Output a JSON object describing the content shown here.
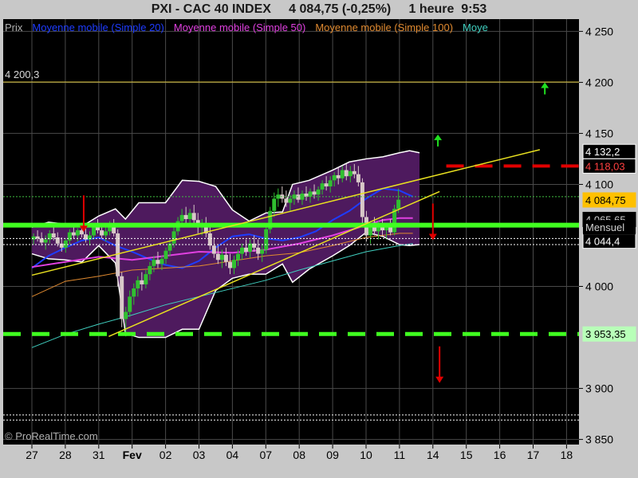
{
  "chart_data": {
    "type": "candlestick",
    "title": "PXI - CAC 40 INDEX     4 084,75 (-0,25%)     1 heure  9:53",
    "legend": [
      {
        "label": "Prix",
        "color": "#b0b0b0"
      },
      {
        "label": "Moyenne mobile (Simple 20)",
        "color": "#1e3cff"
      },
      {
        "label": "Moyenne mobile (Simple 50)",
        "color": "#e040e0"
      },
      {
        "label": "Moyenne mobile (Simple 100)",
        "color": "#e08a30"
      },
      {
        "label": "Moye",
        "color": "#40d0c0"
      }
    ],
    "y_ticks": [
      {
        "value": 4250,
        "label": "4 250"
      },
      {
        "value": 4200,
        "label": "4 200"
      },
      {
        "value": 4150,
        "label": "4 150"
      },
      {
        "value": 4100,
        "label": "4 100"
      },
      {
        "value": 4000,
        "label": "4 000"
      },
      {
        "value": 3900,
        "label": "3 900"
      },
      {
        "value": 3850,
        "label": "3 850"
      }
    ],
    "ylim": [
      3845,
      4262
    ],
    "x_labels": [
      "27",
      "28",
      "31",
      "Fev",
      "02",
      "03",
      "04",
      "07",
      "08",
      "09",
      "10",
      "11",
      "14",
      "15",
      "16",
      "17",
      "18"
    ],
    "price_tags": [
      {
        "value": 4132.2,
        "label": "4 132,2",
        "bg": "#000000",
        "fg": "#ffffff",
        "border": "#ffffff"
      },
      {
        "value": 4118.03,
        "label": "4 118,03",
        "bg": "#000000",
        "fg": "#ff4040",
        "border": "#ffffff"
      },
      {
        "value": 4084.75,
        "label": "4 084,75",
        "bg": "#ffc000",
        "fg": "#000000",
        "border": "#ffc000"
      },
      {
        "value": 4065.65,
        "label": "4 065,65",
        "bg": "#000000",
        "fg": "#d0d0d0",
        "border": "#000000"
      },
      {
        "value": 4044.4,
        "label": "4 044,4",
        "bg": "#000000",
        "fg": "#ffffff",
        "border": "#ffffff"
      },
      {
        "value": 3953.35,
        "label": "3 953,35",
        "bg": "#b8ffb8",
        "fg": "#000000",
        "border": "#b8ffb8"
      }
    ],
    "level_labels": [
      {
        "value": 4200.3,
        "label": "4 200,3"
      },
      {
        "value": 4058,
        "label": "Mensuel"
      }
    ],
    "horizontal_levels": [
      {
        "value": 4200.3,
        "style": "solid",
        "color": "#e8d040",
        "width": 1
      },
      {
        "value": 4118.03,
        "style": "dashed",
        "color": "#e00000",
        "width": 4,
        "from_x": 12.4
      },
      {
        "value": 4088,
        "style": "dotted",
        "color": "#40c040",
        "width": 1
      },
      {
        "value": 4060,
        "style": "solid",
        "color": "#40ff20",
        "width": 6
      },
      {
        "value": 4047,
        "style": "dotted",
        "color": "#ffffff",
        "width": 1
      },
      {
        "value": 4041,
        "style": "dotted",
        "color": "#ffffff",
        "width": 1
      },
      {
        "value": 3953.35,
        "style": "dashed",
        "color": "#40ff20",
        "width": 5
      },
      {
        "value": 3874,
        "style": "dotted",
        "color": "#ffffff",
        "width": 1
      },
      {
        "value": 3869,
        "style": "dotted",
        "color": "#ffffff",
        "width": 1
      }
    ],
    "trend_lines": [
      {
        "points": [
          [
            0,
            4011
          ],
          [
            15.2,
            4134
          ]
        ],
        "color": "#e8e020"
      },
      {
        "points": [
          [
            2.3,
            3951
          ],
          [
            12.2,
            4093
          ]
        ],
        "color": "#e8e020"
      }
    ],
    "arrows": [
      {
        "x": 15.35,
        "value": 4196,
        "direction": "up",
        "color": "#20e020"
      },
      {
        "x": 12.15,
        "value": 4145,
        "direction": "up",
        "color": "#20e020"
      },
      {
        "x": 12.0,
        "value": 4050,
        "direction": "down",
        "color": "#e00000"
      },
      {
        "x": 12.2,
        "value": 3910,
        "direction": "down",
        "color": "#e00000"
      },
      {
        "x": 1.55,
        "value": 4058,
        "direction": "down",
        "color": "#e00000"
      }
    ],
    "bollinger": {
      "x": [
        0,
        0.5,
        1,
        1.5,
        2,
        2.5,
        2.8,
        3.2,
        4,
        4.5,
        5,
        5.5,
        6,
        6.5,
        7,
        7.5,
        7.8,
        8.3,
        9,
        9.5,
        10,
        10.5,
        11,
        11.3,
        11.6
      ],
      "upper": [
        4058,
        4063,
        4061,
        4059,
        4069,
        4076,
        4066,
        4082,
        4082,
        4104,
        4103,
        4098,
        4075,
        4064,
        4072,
        4073,
        4100,
        4104,
        4114,
        4122,
        4125,
        4127,
        4131,
        4133,
        4131
      ],
      "lower": [
        4032,
        4027,
        4026,
        4024,
        4040,
        4023,
        3954,
        3950,
        3950,
        3958,
        3958,
        3996,
        4008,
        4012,
        4012,
        4022,
        4004,
        4017,
        4030,
        4040,
        4053,
        4049,
        4041,
        4040,
        4041
      ]
    },
    "moving_averages": [
      {
        "name": "Moyenne mobile (Simple 20)",
        "color": "#1e3cff",
        "width": 2,
        "x": [
          0,
          0.5,
          1,
          1.5,
          2,
          2.5,
          3,
          3.5,
          4,
          4.5,
          5,
          5.5,
          6,
          6.5,
          7,
          7.5,
          8,
          8.5,
          9,
          9.5,
          10,
          10.5,
          11,
          11.4
        ],
        "values": [
          4018,
          4030,
          4038,
          4045,
          4048,
          4040,
          4034,
          4027,
          4021,
          4018,
          4025,
          4038,
          4049,
          4051,
          4047,
          4045,
          4048,
          4054,
          4065,
          4074,
          4086,
          4096,
          4094,
          4088
        ]
      },
      {
        "name": "Moyenne mobile (Simple 50)",
        "color": "#e040e0",
        "width": 2,
        "x": [
          0,
          1,
          2,
          3,
          4,
          5,
          6,
          7,
          8,
          9,
          10,
          10.5,
          11,
          11.4
        ],
        "values": [
          4019,
          4024,
          4029,
          4026,
          4030,
          4034,
          4033,
          4036,
          4042,
          4050,
          4060,
          4065,
          4067,
          4067
        ]
      },
      {
        "name": "Moyenne mobile (Simple 100)",
        "color": "#e08a30",
        "width": 1,
        "x": [
          0,
          1,
          2,
          3,
          4,
          5,
          6,
          7,
          8,
          9,
          10,
          11,
          11.4
        ],
        "values": [
          3990,
          4005,
          4010,
          4016,
          4018,
          4020,
          4025,
          4030,
          4033,
          4040,
          4048,
          4052,
          4052
        ]
      },
      {
        "name": "Moye",
        "color": "#40d0c0",
        "width": 1,
        "x": [
          0,
          1,
          2,
          3,
          4,
          5,
          6,
          7,
          8,
          9,
          10,
          11,
          11.4
        ],
        "values": [
          3940,
          3953,
          3963,
          3972,
          3982,
          3990,
          3998,
          4006,
          4016,
          4025,
          4034,
          4040,
          4042
        ]
      }
    ],
    "candles": [
      {
        "x": 0.05,
        "o": 4046,
        "h": 4052,
        "l": 4041,
        "c": 4049
      },
      {
        "x": 0.17,
        "o": 4049,
        "h": 4055,
        "l": 4044,
        "c": 4047
      },
      {
        "x": 0.29,
        "o": 4047,
        "h": 4053,
        "l": 4040,
        "c": 4043
      },
      {
        "x": 0.41,
        "o": 4043,
        "h": 4050,
        "l": 4036,
        "c": 4046
      },
      {
        "x": 0.53,
        "o": 4046,
        "h": 4055,
        "l": 4042,
        "c": 4052
      },
      {
        "x": 0.65,
        "o": 4052,
        "h": 4058,
        "l": 4045,
        "c": 4048
      },
      {
        "x": 0.77,
        "o": 4048,
        "h": 4053,
        "l": 4039,
        "c": 4042
      },
      {
        "x": 0.89,
        "o": 4042,
        "h": 4048,
        "l": 4034,
        "c": 4038
      },
      {
        "x": 1.01,
        "o": 4038,
        "h": 4047,
        "l": 4033,
        "c": 4045
      },
      {
        "x": 1.13,
        "o": 4045,
        "h": 4056,
        "l": 4041,
        "c": 4053
      },
      {
        "x": 1.25,
        "o": 4053,
        "h": 4061,
        "l": 4047,
        "c": 4050
      },
      {
        "x": 1.37,
        "o": 4050,
        "h": 4057,
        "l": 4044,
        "c": 4055
      },
      {
        "x": 1.49,
        "o": 4055,
        "h": 4062,
        "l": 4048,
        "c": 4051
      },
      {
        "x": 1.61,
        "o": 4051,
        "h": 4058,
        "l": 4043,
        "c": 4046
      },
      {
        "x": 1.73,
        "o": 4046,
        "h": 4054,
        "l": 4040,
        "c": 4050
      },
      {
        "x": 1.85,
        "o": 4050,
        "h": 4062,
        "l": 4046,
        "c": 4059
      },
      {
        "x": 1.97,
        "o": 4059,
        "h": 4066,
        "l": 4052,
        "c": 4055
      },
      {
        "x": 2.09,
        "o": 4055,
        "h": 4062,
        "l": 4047,
        "c": 4050
      },
      {
        "x": 2.21,
        "o": 4050,
        "h": 4058,
        "l": 4044,
        "c": 4054
      },
      {
        "x": 2.33,
        "o": 4054,
        "h": 4064,
        "l": 4050,
        "c": 4060
      },
      {
        "x": 2.45,
        "o": 4060,
        "h": 4066,
        "l": 4049,
        "c": 4052
      },
      {
        "x": 2.57,
        "o": 4052,
        "h": 4056,
        "l": 4000,
        "c": 4010
      },
      {
        "x": 2.69,
        "o": 4010,
        "h": 4014,
        "l": 3960,
        "c": 3968
      },
      {
        "x": 2.81,
        "o": 3968,
        "h": 3980,
        "l": 3951,
        "c": 3975
      },
      {
        "x": 2.93,
        "o": 3975,
        "h": 3996,
        "l": 3970,
        "c": 3990
      },
      {
        "x": 3.05,
        "o": 3990,
        "h": 4003,
        "l": 3982,
        "c": 3998
      },
      {
        "x": 3.17,
        "o": 3998,
        "h": 4010,
        "l": 3990,
        "c": 4006
      },
      {
        "x": 3.29,
        "o": 4006,
        "h": 4014,
        "l": 3996,
        "c": 4002
      },
      {
        "x": 3.41,
        "o": 4002,
        "h": 4016,
        "l": 3998,
        "c": 4012
      },
      {
        "x": 3.53,
        "o": 4012,
        "h": 4024,
        "l": 4006,
        "c": 4020
      },
      {
        "x": 3.65,
        "o": 4020,
        "h": 4030,
        "l": 4014,
        "c": 4026
      },
      {
        "x": 3.77,
        "o": 4026,
        "h": 4034,
        "l": 4018,
        "c": 4022
      },
      {
        "x": 3.89,
        "o": 4022,
        "h": 4030,
        "l": 4016,
        "c": 4027
      },
      {
        "x": 4.01,
        "o": 4027,
        "h": 4038,
        "l": 4022,
        "c": 4035
      },
      {
        "x": 4.13,
        "o": 4035,
        "h": 4046,
        "l": 4030,
        "c": 4042
      },
      {
        "x": 4.25,
        "o": 4042,
        "h": 4058,
        "l": 4038,
        "c": 4054
      },
      {
        "x": 4.37,
        "o": 4054,
        "h": 4068,
        "l": 4050,
        "c": 4064
      },
      {
        "x": 4.49,
        "o": 4064,
        "h": 4076,
        "l": 4058,
        "c": 4070
      },
      {
        "x": 4.61,
        "o": 4070,
        "h": 4078,
        "l": 4062,
        "c": 4066
      },
      {
        "x": 4.73,
        "o": 4066,
        "h": 4076,
        "l": 4058,
        "c": 4072
      },
      {
        "x": 4.85,
        "o": 4072,
        "h": 4080,
        "l": 4062,
        "c": 4065
      },
      {
        "x": 4.97,
        "o": 4065,
        "h": 4072,
        "l": 4052,
        "c": 4058
      },
      {
        "x": 5.09,
        "o": 4058,
        "h": 4066,
        "l": 4050,
        "c": 4062
      },
      {
        "x": 5.21,
        "o": 4062,
        "h": 4068,
        "l": 4048,
        "c": 4052
      },
      {
        "x": 5.33,
        "o": 4052,
        "h": 4058,
        "l": 4036,
        "c": 4040
      },
      {
        "x": 5.45,
        "o": 4040,
        "h": 4048,
        "l": 4028,
        "c": 4032
      },
      {
        "x": 5.57,
        "o": 4032,
        "h": 4040,
        "l": 4022,
        "c": 4026
      },
      {
        "x": 5.69,
        "o": 4026,
        "h": 4036,
        "l": 4018,
        "c": 4031
      },
      {
        "x": 5.81,
        "o": 4031,
        "h": 4038,
        "l": 4020,
        "c": 4024
      },
      {
        "x": 5.93,
        "o": 4024,
        "h": 4032,
        "l": 4012,
        "c": 4018
      },
      {
        "x": 6.05,
        "o": 4018,
        "h": 4030,
        "l": 4012,
        "c": 4026
      },
      {
        "x": 6.17,
        "o": 4026,
        "h": 4036,
        "l": 4020,
        "c": 4032
      },
      {
        "x": 6.29,
        "o": 4032,
        "h": 4042,
        "l": 4026,
        "c": 4038
      },
      {
        "x": 6.41,
        "o": 4038,
        "h": 4046,
        "l": 4030,
        "c": 4034
      },
      {
        "x": 6.53,
        "o": 4034,
        "h": 4046,
        "l": 4028,
        "c": 4042
      },
      {
        "x": 6.65,
        "o": 4042,
        "h": 4050,
        "l": 4034,
        "c": 4038
      },
      {
        "x": 6.77,
        "o": 4038,
        "h": 4046,
        "l": 4026,
        "c": 4032
      },
      {
        "x": 6.89,
        "o": 4032,
        "h": 4042,
        "l": 4024,
        "c": 4036
      },
      {
        "x": 7.01,
        "o": 4036,
        "h": 4060,
        "l": 4032,
        "c": 4056
      },
      {
        "x": 7.13,
        "o": 4056,
        "h": 4078,
        "l": 4052,
        "c": 4074
      },
      {
        "x": 7.25,
        "o": 4074,
        "h": 4092,
        "l": 4068,
        "c": 4086
      },
      {
        "x": 7.37,
        "o": 4086,
        "h": 4096,
        "l": 4078,
        "c": 4090
      },
      {
        "x": 7.49,
        "o": 4090,
        "h": 4098,
        "l": 4082,
        "c": 4086
      },
      {
        "x": 7.61,
        "o": 4086,
        "h": 4094,
        "l": 4078,
        "c": 4082
      },
      {
        "x": 7.73,
        "o": 4082,
        "h": 4090,
        "l": 4074,
        "c": 4086
      },
      {
        "x": 7.85,
        "o": 4086,
        "h": 4094,
        "l": 4080,
        "c": 4090
      },
      {
        "x": 7.97,
        "o": 4090,
        "h": 4097,
        "l": 4082,
        "c": 4085
      },
      {
        "x": 8.09,
        "o": 4085,
        "h": 4094,
        "l": 4080,
        "c": 4091
      },
      {
        "x": 8.21,
        "o": 4091,
        "h": 4098,
        "l": 4084,
        "c": 4088
      },
      {
        "x": 8.33,
        "o": 4088,
        "h": 4096,
        "l": 4082,
        "c": 4093
      },
      {
        "x": 8.45,
        "o": 4093,
        "h": 4100,
        "l": 4086,
        "c": 4090
      },
      {
        "x": 8.57,
        "o": 4090,
        "h": 4098,
        "l": 4084,
        "c": 4095
      },
      {
        "x": 8.69,
        "o": 4095,
        "h": 4104,
        "l": 4090,
        "c": 4101
      },
      {
        "x": 8.81,
        "o": 4101,
        "h": 4108,
        "l": 4094,
        "c": 4098
      },
      {
        "x": 8.93,
        "o": 4098,
        "h": 4108,
        "l": 4092,
        "c": 4104
      },
      {
        "x": 9.05,
        "o": 4104,
        "h": 4112,
        "l": 4098,
        "c": 4109
      },
      {
        "x": 9.17,
        "o": 4109,
        "h": 4116,
        "l": 4100,
        "c": 4106
      },
      {
        "x": 9.29,
        "o": 4106,
        "h": 4118,
        "l": 4102,
        "c": 4114
      },
      {
        "x": 9.41,
        "o": 4114,
        "h": 4120,
        "l": 4104,
        "c": 4108
      },
      {
        "x": 9.53,
        "o": 4108,
        "h": 4118,
        "l": 4102,
        "c": 4113
      },
      {
        "x": 9.65,
        "o": 4113,
        "h": 4120,
        "l": 4106,
        "c": 4110
      },
      {
        "x": 9.77,
        "o": 4110,
        "h": 4118,
        "l": 4098,
        "c": 4102
      },
      {
        "x": 9.89,
        "o": 4102,
        "h": 4106,
        "l": 4062,
        "c": 4068
      },
      {
        "x": 10.01,
        "o": 4068,
        "h": 4074,
        "l": 4044,
        "c": 4050
      },
      {
        "x": 10.13,
        "o": 4050,
        "h": 4062,
        "l": 4042,
        "c": 4058
      },
      {
        "x": 10.25,
        "o": 4058,
        "h": 4068,
        "l": 4050,
        "c": 4054
      },
      {
        "x": 10.37,
        "o": 4054,
        "h": 4064,
        "l": 4046,
        "c": 4060
      },
      {
        "x": 10.49,
        "o": 4060,
        "h": 4066,
        "l": 4050,
        "c": 4055
      },
      {
        "x": 10.61,
        "o": 4055,
        "h": 4062,
        "l": 4046,
        "c": 4058
      },
      {
        "x": 10.73,
        "o": 4058,
        "h": 4066,
        "l": 4050,
        "c": 4053
      },
      {
        "x": 10.85,
        "o": 4053,
        "h": 4080,
        "l": 4050,
        "c": 4076
      },
      {
        "x": 10.97,
        "o": 4076,
        "h": 4096,
        "l": 4072,
        "c": 4085
      }
    ]
  },
  "watermark": "© ProRealTime.com",
  "colors": {
    "plot_bg": "#000000",
    "frame_bg": "#c8c8c8",
    "grid": "#4a4a4a",
    "band_fill": "#4e1a5e",
    "band_edge": "#ffffff",
    "candle_up": "#30c030",
    "candle_down": "#d8c8c8"
  }
}
